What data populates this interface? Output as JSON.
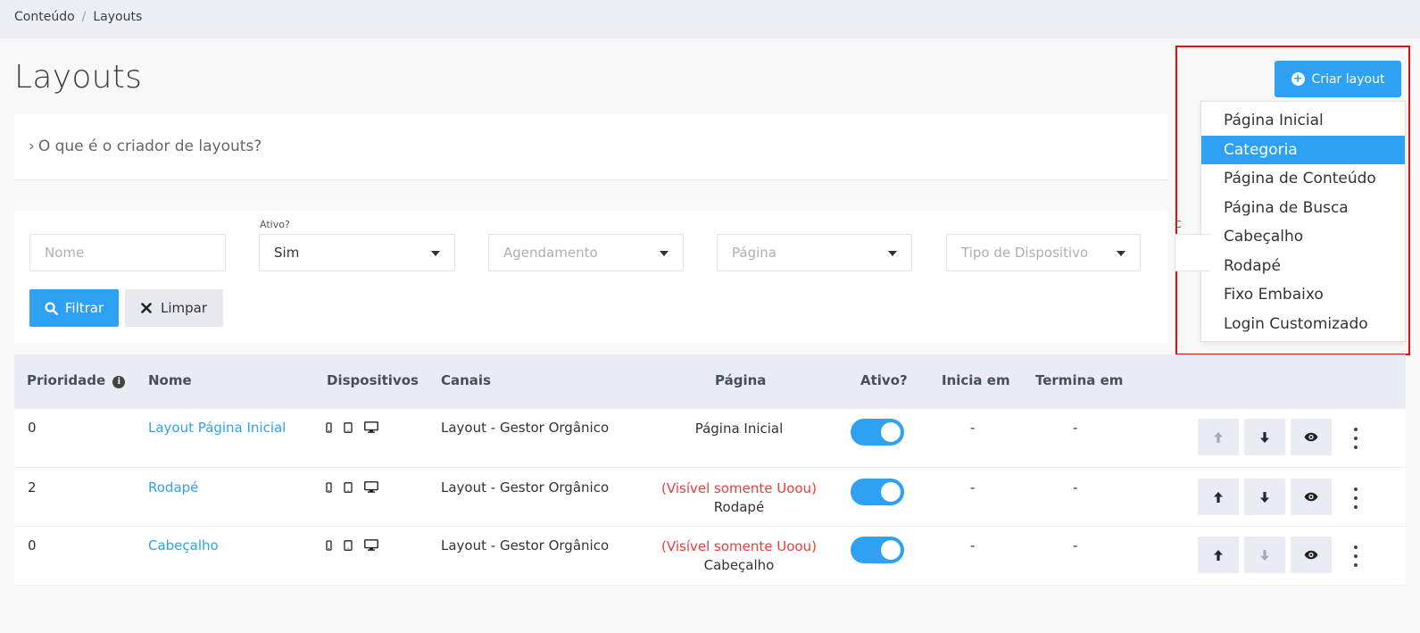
{
  "breadcrumb": {
    "items": [
      "Conteúdo",
      "Layouts"
    ],
    "separator": "/"
  },
  "page_title": "Layouts",
  "create_button": {
    "label": "Criar layout",
    "icon": "plus-circle-icon"
  },
  "dropdown": {
    "items": [
      "Página Inicial",
      "Categoria",
      "Página de Conteúdo",
      "Página de Busca",
      "Cabeçalho",
      "Rodapé",
      "Fixo Embaixo",
      "Login Customizado"
    ],
    "highlighted": "Categoria"
  },
  "faq": {
    "label": "O que é o criador de layouts?"
  },
  "filters": {
    "nome_placeholder": "Nome",
    "ativo_label": "Ativo?",
    "ativo_value": "Sim",
    "agendamento_placeholder": "Agendamento",
    "pagina_placeholder": "Página",
    "tipo_dispositivo_placeholder": "Tipo de Dispositivo",
    "hidden_label_fragment": "C",
    "filter_button": "Filtrar",
    "clear_button": "Limpar"
  },
  "table": {
    "headers": {
      "prioridade": "Prioridade",
      "nome": "Nome",
      "dispositivos": "Dispositivos",
      "canais": "Canais",
      "pagina": "Página",
      "ativo": "Ativo?",
      "inicia": "Inicia em",
      "termina": "Termina em"
    },
    "rows": [
      {
        "prioridade": "0",
        "nome": "Layout Página Inicial",
        "canais": "Layout - Gestor Orgânico",
        "pagina_warning": "",
        "pagina": "Página Inicial",
        "ativo": true,
        "inicia": "-",
        "termina": "-",
        "up_enabled": false,
        "down_enabled": true
      },
      {
        "prioridade": "2",
        "nome": "Rodapé",
        "canais": "Layout - Gestor Orgânico",
        "pagina_warning": "(Visível somente Uoou)",
        "pagina": "Rodapé",
        "ativo": true,
        "inicia": "-",
        "termina": "-",
        "up_enabled": true,
        "down_enabled": true
      },
      {
        "prioridade": "0",
        "nome": "Cabeçalho",
        "canais": "Layout - Gestor Orgânico",
        "pagina_warning": "(Visível somente Uoou)",
        "pagina": "Cabeçalho",
        "ativo": true,
        "inicia": "-",
        "termina": "-",
        "up_enabled": true,
        "down_enabled": false
      }
    ]
  },
  "colors": {
    "accent": "#2ea1f3",
    "warning": "#f03a3a",
    "highlight_outline": "#e01010"
  }
}
